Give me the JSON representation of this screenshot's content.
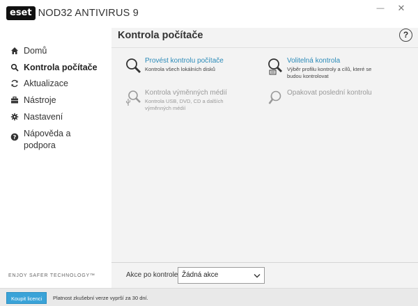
{
  "app": {
    "logo_text": "eset",
    "title": "NOD32 ANTIVIRUS 9",
    "minimize_label": "—",
    "close_label": "✕"
  },
  "sidebar": {
    "items": [
      {
        "label": "Domů",
        "icon": "home-icon",
        "active": false
      },
      {
        "label": "Kontrola počítače",
        "icon": "search-icon",
        "active": true
      },
      {
        "label": "Aktualizace",
        "icon": "refresh-icon",
        "active": false
      },
      {
        "label": "Nástroje",
        "icon": "briefcase-icon",
        "active": false
      },
      {
        "label": "Nastavení",
        "icon": "gear-icon",
        "active": false
      },
      {
        "label": "Nápověda a podpora",
        "icon": "help-icon",
        "active": false
      }
    ],
    "tagline": "ENJOY SAFER TECHNOLOGY™"
  },
  "main": {
    "title": "Kontrola počítače",
    "help_label": "?",
    "tiles": [
      {
        "title": "Provést kontrolu počítače",
        "desc": "Kontrola všech lokálních disků",
        "icon": "magnifier-icon",
        "enabled": true
      },
      {
        "title": "Volitelná kontrola",
        "desc": "Výběr profilu kontroly a cílů, které se budou kontrolovat",
        "icon": "custom-scan-icon",
        "enabled": true
      },
      {
        "title": "Kontrola výměnných médií",
        "desc": "Kontrola USB, DVD, CD a dalších výměnných médií",
        "icon": "usb-scan-icon",
        "enabled": false
      },
      {
        "title": "Opakovat poslední kontrolu",
        "desc": "",
        "icon": "repeat-scan-icon",
        "enabled": false
      }
    ],
    "action": {
      "label": "Akce po kontrole",
      "selected": "Žádná akce"
    }
  },
  "status": {
    "buy_label": "Koupit licenci",
    "trial_text": "Platnost zkušební verze vyprší za 30 dní."
  },
  "colors": {
    "accent": "#2a8ab8",
    "buy_button": "#3aa3d8",
    "content_bg": "#f3f3f3",
    "disabled_text": "#999999"
  }
}
